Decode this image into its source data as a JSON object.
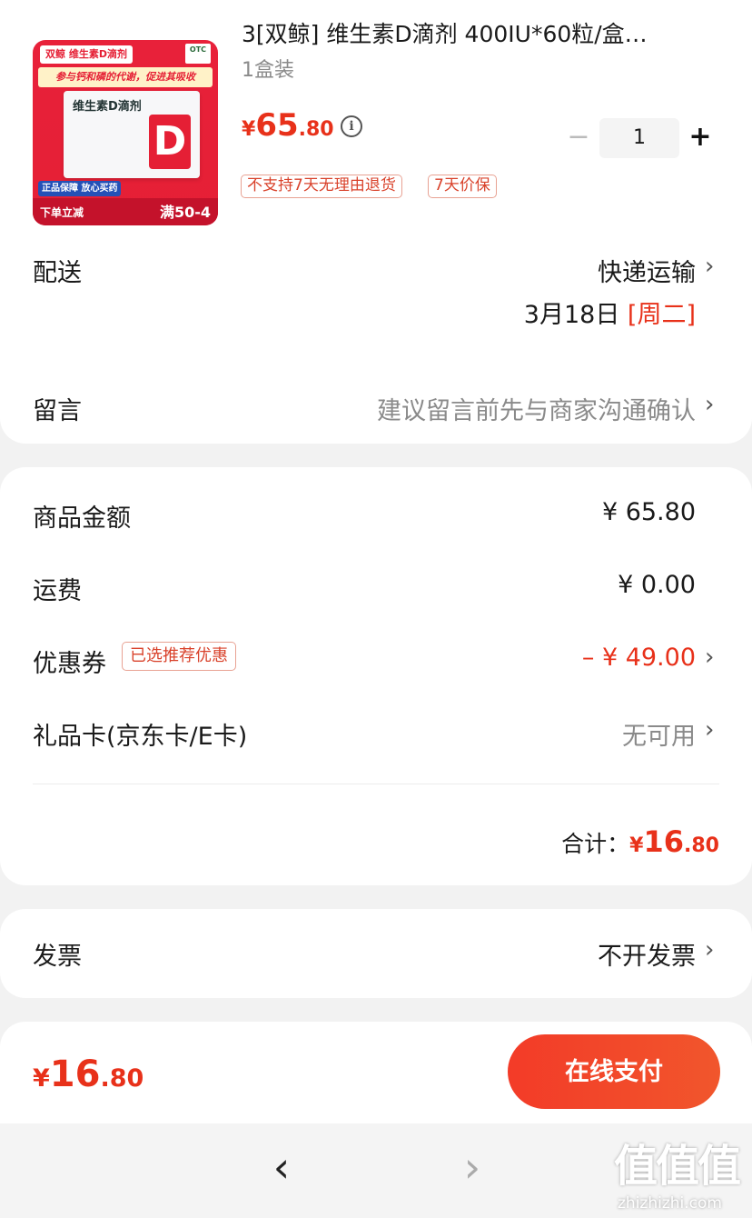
{
  "product": {
    "title": "3[双鲸] 维生素D滴剂 400IU*60粒/盒…",
    "spec": "1盒装",
    "price_currency": "¥",
    "price_int": "65",
    "price_dec": ".80",
    "info_icon": "i",
    "quantity": "1",
    "minus_label": "−",
    "plus_label": "+",
    "tags": [
      "不支持7天无理由退货",
      "7天价保"
    ],
    "image_text": {
      "top_label": "双鲸 维生素D滴剂",
      "otc": "OTC",
      "slogan": "参与钙和磷的代谢，促进其吸收",
      "box_title": "维生素D滴剂",
      "box_letter": "D",
      "badge_a": "正品保障 放心买药",
      "bottom_a": "下单立减",
      "bottom_b": "满50-4"
    }
  },
  "delivery": {
    "label": "配送",
    "method": "快递运输",
    "date": "3月18日",
    "weekday": "[周二]"
  },
  "message": {
    "label": "留言",
    "placeholder": "建议留言前先与商家沟通确认"
  },
  "summary": {
    "goods_label": "商品金额",
    "goods_value": "¥ 65.80",
    "shipping_label": "运费",
    "shipping_value": "¥ 0.00",
    "coupon_label": "优惠券",
    "coupon_tag": "已选推荐优惠",
    "coupon_value": "– ¥ 49.00",
    "giftcard_label": "礼品卡(京东卡/E卡)",
    "giftcard_value": "无可用",
    "total_label": "合计：",
    "total_currency": "¥",
    "total_int": "16",
    "total_dec": ".80"
  },
  "invoice": {
    "label": "发票",
    "value": "不开发票"
  },
  "paybar": {
    "currency": "¥",
    "int": "16",
    "dec": ".80",
    "button": "在线支付"
  },
  "nav": {
    "back": "‹",
    "forward": "›"
  },
  "watermark": {
    "logo": "值值值",
    "url": "zhizhizhi.com"
  },
  "chevron": "›",
  "colors": {
    "accent": "#e8311a",
    "pay_button": "#f33b28",
    "tag_border": "#e8a293",
    "muted_text": "#8a8a8a",
    "background": "#f2f2f2"
  }
}
